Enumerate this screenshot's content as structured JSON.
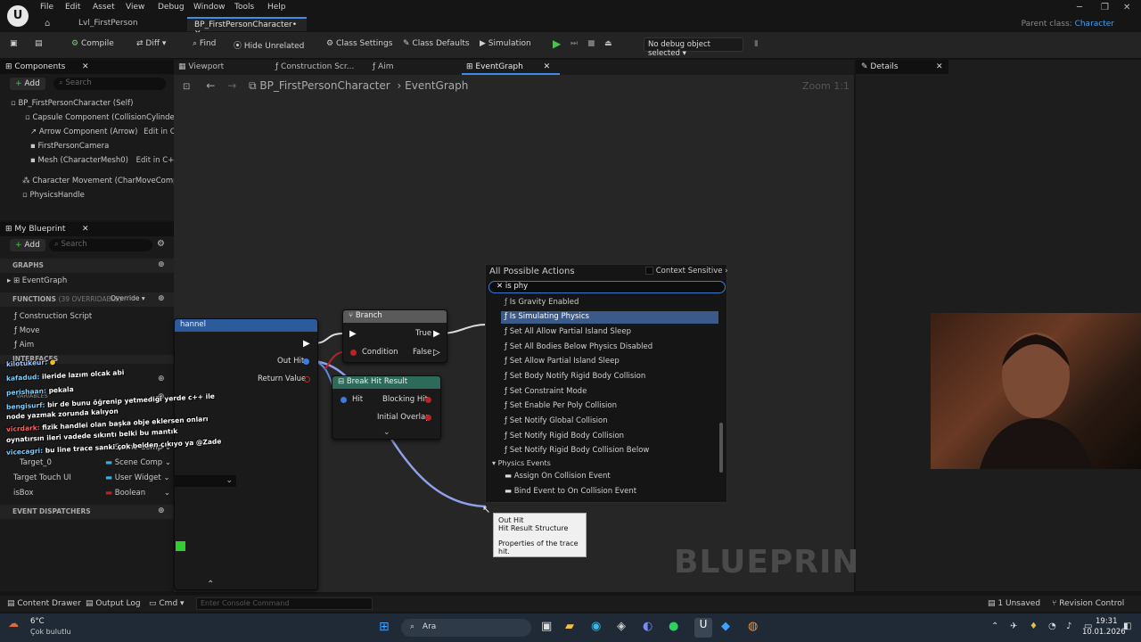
{
  "menubar": {
    "items": [
      "File",
      "Edit",
      "Asset",
      "View",
      "Debug",
      "Window",
      "Tools",
      "Help"
    ],
    "parent_class_label": "Parent class:",
    "parent_class_value": "Character"
  },
  "doc_tabs": [
    {
      "label": "Lvl_FirstPerson"
    },
    {
      "label": "BP_FirstPersonCharacter•"
    }
  ],
  "toolbar": {
    "compile": "Compile",
    "diff": "Diff",
    "find": "Find",
    "hide_unrelated": "Hide Unrelated",
    "class_settings": "Class Settings",
    "class_defaults": "Class Defaults",
    "simulation": "Simulation",
    "debug_select": "No debug object selected"
  },
  "components": {
    "tab": "Components",
    "add": "Add",
    "search_placeholder": "Search",
    "items": [
      {
        "label": "BP_FirstPersonCharacter (Self)"
      },
      {
        "label": "Capsule Component (CollisionCylinder)"
      },
      {
        "label": "Arrow Component (Arrow)",
        "edit": "Edit in C++"
      },
      {
        "label": "FirstPersonCamera"
      },
      {
        "label": "Mesh (CharacterMesh0)",
        "edit": "Edit in C++"
      },
      {
        "label": "Character Movement (CharMoveComp)"
      },
      {
        "label": "PhysicsHandle"
      }
    ]
  },
  "my_blueprint": {
    "tab": "My Blueprint",
    "add": "Add",
    "search_placeholder": "Search",
    "graphs_header": "GRAPHS",
    "graph_item": "EventGraph",
    "functions_header": "FUNCTIONS",
    "functions_count": "(39 OVERRIDABLE)",
    "override": "Override",
    "functions": [
      "Construction Script",
      "Move",
      "Aim"
    ],
    "interfaces_header": "INTERFACES",
    "variables_header": "VARIABLES",
    "variables": [
      {
        "name": "Target_0",
        "type": "Scene Comp"
      },
      {
        "name": "Target Touch UI",
        "type": "User Widget"
      },
      {
        "name": "isBox",
        "type": "Boolean"
      }
    ],
    "partial_type": "Scene Comp",
    "dispatchers_header": "EVENT DISPATCHERS"
  },
  "graph_tabs": [
    "Viewport",
    "Construction Scr...",
    "Aim",
    "EventGraph"
  ],
  "breadcrumb": {
    "root": "BP_FirstPersonCharacter",
    "current": "EventGraph"
  },
  "zoom": "Zoom 1:1",
  "watermark": "BLUEPRINT",
  "details": {
    "tab": "Details"
  },
  "nodes": {
    "trace": {
      "title": "hannel",
      "out_hit": "Out Hit",
      "return_value": "Return Value"
    },
    "branch": {
      "title": "Branch",
      "condition": "Condition",
      "true": "True",
      "false": "False"
    },
    "break": {
      "title": "Break Hit Result",
      "hit": "Hit",
      "blocking_hit": "Blocking Hit",
      "initial_overlap": "Initial Overlap"
    }
  },
  "context_menu": {
    "title": "All Possible Actions",
    "sensitive": "Context Sensitive",
    "search_value": "is phy",
    "items": [
      {
        "label": "Is Gravity Enabled",
        "selected": false
      },
      {
        "label": "Is Simulating Physics",
        "selected": true
      },
      {
        "label": "Set All Allow Partial Island Sleep",
        "selected": false
      },
      {
        "label": "Set All Bodies Below Physics Disabled",
        "selected": false
      },
      {
        "label": "Set Allow Partial Island Sleep",
        "selected": false
      },
      {
        "label": "Set Body Notify Rigid Body Collision",
        "selected": false
      },
      {
        "label": "Set Constraint Mode",
        "selected": false
      },
      {
        "label": "Set Enable Per Poly Collision",
        "selected": false
      },
      {
        "label": "Set Notify Global Collision",
        "selected": false
      },
      {
        "label": "Set Notify Rigid Body Collision",
        "selected": false
      },
      {
        "label": "Set Notify Rigid Body Collision Below",
        "selected": false
      }
    ],
    "category": "Physics Events",
    "category_items": [
      "Assign On Collision Event",
      "Bind Event to On Collision Event"
    ]
  },
  "tooltip": {
    "line1": "Out Hit",
    "line2": "Hit Result Structure",
    "line3": "Properties of the trace hit."
  },
  "chat": [
    {
      "user": "kilotukeur:",
      "msg": ""
    },
    {
      "user": "kafadud:",
      "msg": "ileride lazım olcak abi"
    },
    {
      "user": "perishaan:",
      "msg": "pekala"
    },
    {
      "user": "bengisurf:",
      "msg": "bir de bunu öğrenip yetmediği yerde c++ ile"
    },
    {
      "user": "",
      "msg": "node yazmak zorunda kalıyon"
    },
    {
      "user": "vicrdark:",
      "msg": "fizik handlei olan başka obje eklersen onları"
    },
    {
      "user": "",
      "msg": "oynatırsın ileri vadede sıkıntı belki bu mantık"
    },
    {
      "user": "vicecagri:",
      "msg": "bu line trace sanki çok belden çıkıyo ya @Zade"
    }
  ],
  "statusbar": {
    "content_drawer": "Content Drawer",
    "output_log": "Output Log",
    "cmd": "Cmd",
    "console_placeholder": "Enter Console Command",
    "unsaved": "1 Unsaved",
    "revision": "Revision Control"
  },
  "taskbar": {
    "weather_temp": "6°C",
    "weather_desc": "Çok bulutlu",
    "search": "Ara",
    "time": "19:31",
    "date": "10.01.2026"
  }
}
